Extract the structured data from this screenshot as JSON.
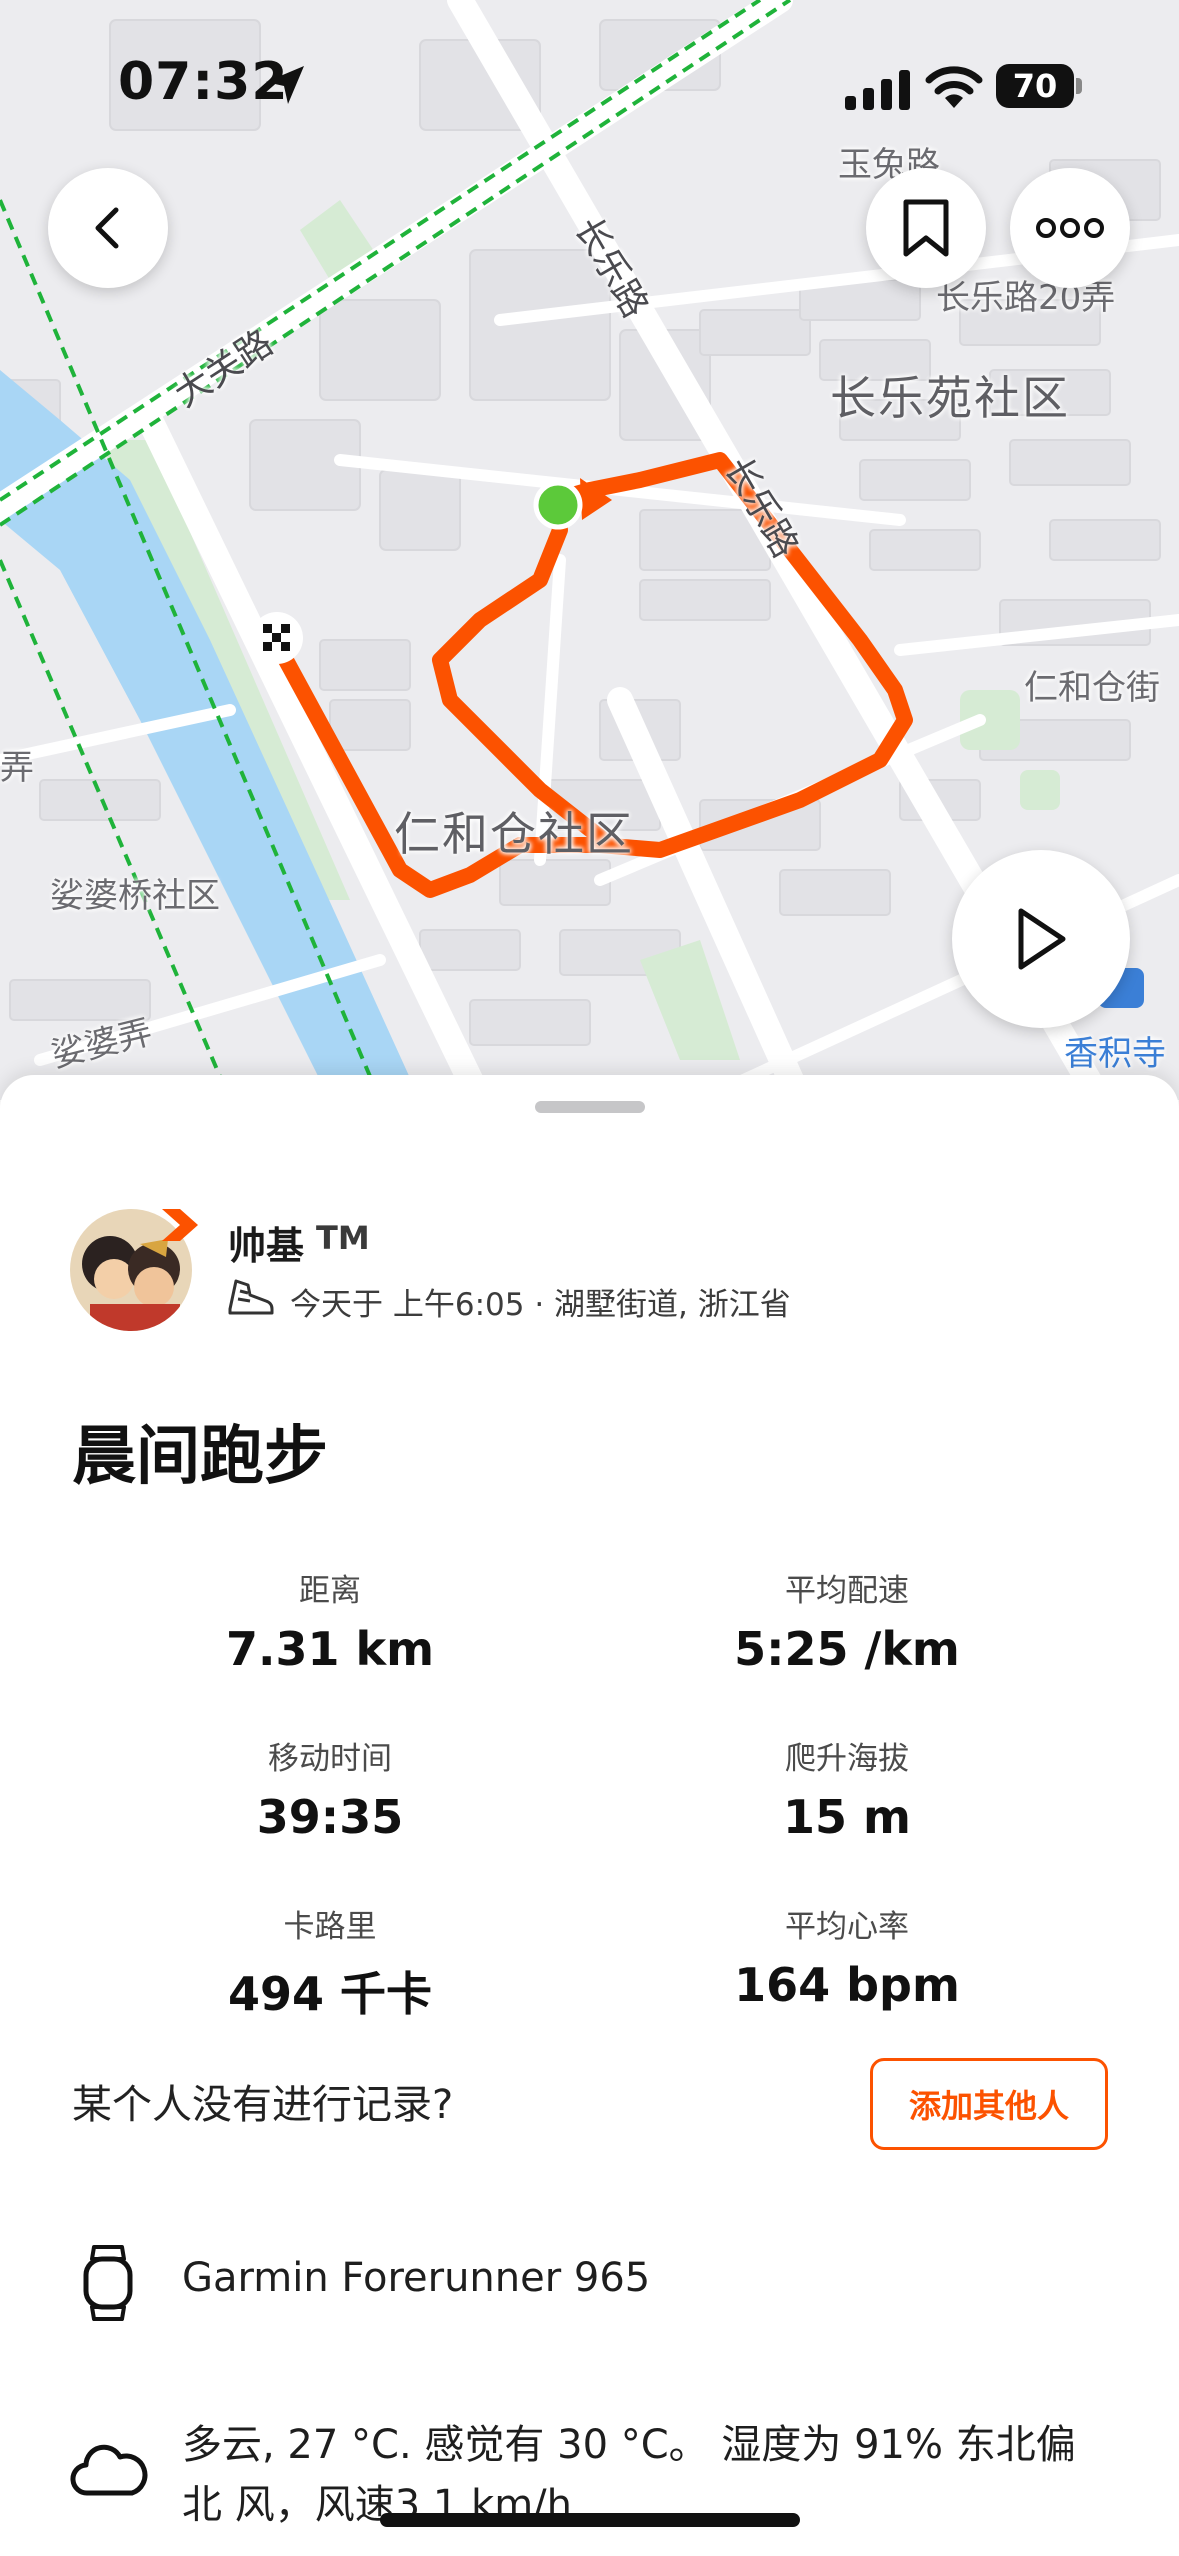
{
  "status_bar": {
    "time": "07:32",
    "battery": "70"
  },
  "map": {
    "labels": {
      "yutu_road": "玉兔路",
      "changle_road_a": "长乐路",
      "changle_road_b": "长乐路",
      "changle_road_20": "长乐路20弄",
      "changleyuan": "长乐苑社区",
      "daguan_road": "大关路",
      "renhecang_street": "仁和仓街",
      "renhecang_community": "仁和仓社区",
      "suopoqiao": "娑婆桥社区",
      "suopo_lane": "娑婆弄",
      "lane_fragment": "弄",
      "xiangjisi": "香积寺"
    },
    "colors": {
      "route": "#fc5200",
      "start": "#5cc93a",
      "water": "#a9d6f5",
      "park": "#cfe8cf",
      "trail": "#1fb33a"
    }
  },
  "buttons": {
    "back": "back",
    "save": "bookmark",
    "more": "more",
    "play": "play"
  },
  "athlete": {
    "name": "帅基",
    "tag": "TM",
    "meta": "今天于 上午6:05 · 湖墅街道, 浙江省"
  },
  "activity": {
    "title": "晨间跑步",
    "stats": [
      {
        "label": "距离",
        "value": "7.31 km"
      },
      {
        "label": "平均配速",
        "value": "5:25 /km"
      },
      {
        "label": "移动时间",
        "value": "39:35"
      },
      {
        "label": "爬升海拔",
        "value": "15 m"
      },
      {
        "label": "卡路里",
        "value": "494 千卡"
      },
      {
        "label": "平均心率",
        "value": "164 bpm"
      }
    ]
  },
  "add_others": {
    "prompt": "某个人没有进行记录?",
    "button": "添加其他人"
  },
  "device": "Garmin Forerunner 965",
  "weather": "多云, 27 °C. 感觉有 30 °C。 湿度为 91% 东北偏北 风，风速3.1 km/h",
  "accent_color": "#fc5200"
}
